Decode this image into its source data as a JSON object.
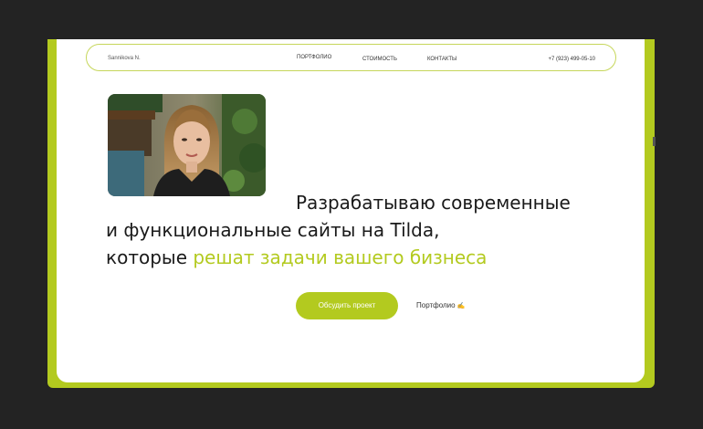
{
  "nav": {
    "brand": "Sannikova N.",
    "items": [
      {
        "label": "ПОРТФОЛИО"
      },
      {
        "label": "СТОИМОСТЬ"
      },
      {
        "label": "КОНТАКТЫ"
      }
    ],
    "phone": "+7 (923) 499-05-10"
  },
  "hero": {
    "line1": "Разрабатываю современные",
    "line2": "и функциональные сайты на Tilda,",
    "line3_prefix": "которые ",
    "line3_accent": "решат задачи вашего бизнеса"
  },
  "actions": {
    "primary_label": "Обсудить проект",
    "secondary_label": "Портфолио",
    "secondary_icon": "✍️"
  },
  "colors": {
    "accent": "#b3ca1f",
    "background": "#232323",
    "card": "#ffffff",
    "text": "#1a1a1a"
  }
}
